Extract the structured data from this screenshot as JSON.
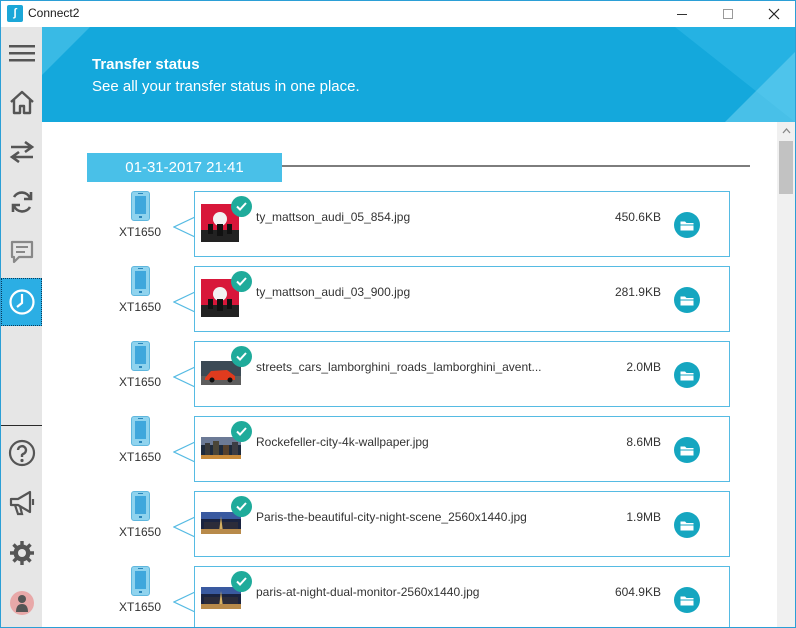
{
  "window": {
    "title": "Connect2"
  },
  "header": {
    "title": "Transfer status",
    "subtitle": "See all your transfer status in one place."
  },
  "sidebar": {
    "items": [
      "menu-icon",
      "home-icon",
      "transfer-icon",
      "sync-icon",
      "messages-icon",
      "history-icon"
    ],
    "bottom_items": [
      "help-icon",
      "megaphone-icon",
      "settings-icon",
      "user-icon"
    ],
    "active": "history-icon"
  },
  "transfer_group": {
    "date": "01-31-2017 21:41",
    "transfers": [
      {
        "device": "XT1650",
        "filename": "ty_mattson_audi_05_854.jpg",
        "size": "450.6KB",
        "thumb": "red"
      },
      {
        "device": "XT1650",
        "filename": "ty_mattson_audi_03_900.jpg",
        "size": "281.9KB",
        "thumb": "red"
      },
      {
        "device": "XT1650",
        "filename": "streets_cars_lamborghini_roads_lamborghini_avent...",
        "size": "2.0MB",
        "thumb": "car"
      },
      {
        "device": "XT1650",
        "filename": "Rockefeller-city-4k-wallpaper.jpg",
        "size": "8.6MB",
        "thumb": "city"
      },
      {
        "device": "XT1650",
        "filename": "Paris-the-beautiful-city-night-scene_2560x1440.jpg",
        "size": "1.9MB",
        "thumb": "night"
      },
      {
        "device": "XT1650",
        "filename": "paris-at-night-dual-monitor-2560x1440.jpg",
        "size": "604.9KB",
        "thumb": "night"
      }
    ]
  },
  "colors": {
    "accent": "#14a8dc",
    "check": "#1fab9b",
    "open": "#15a6c0",
    "sidebar": "#e6e6e6"
  }
}
